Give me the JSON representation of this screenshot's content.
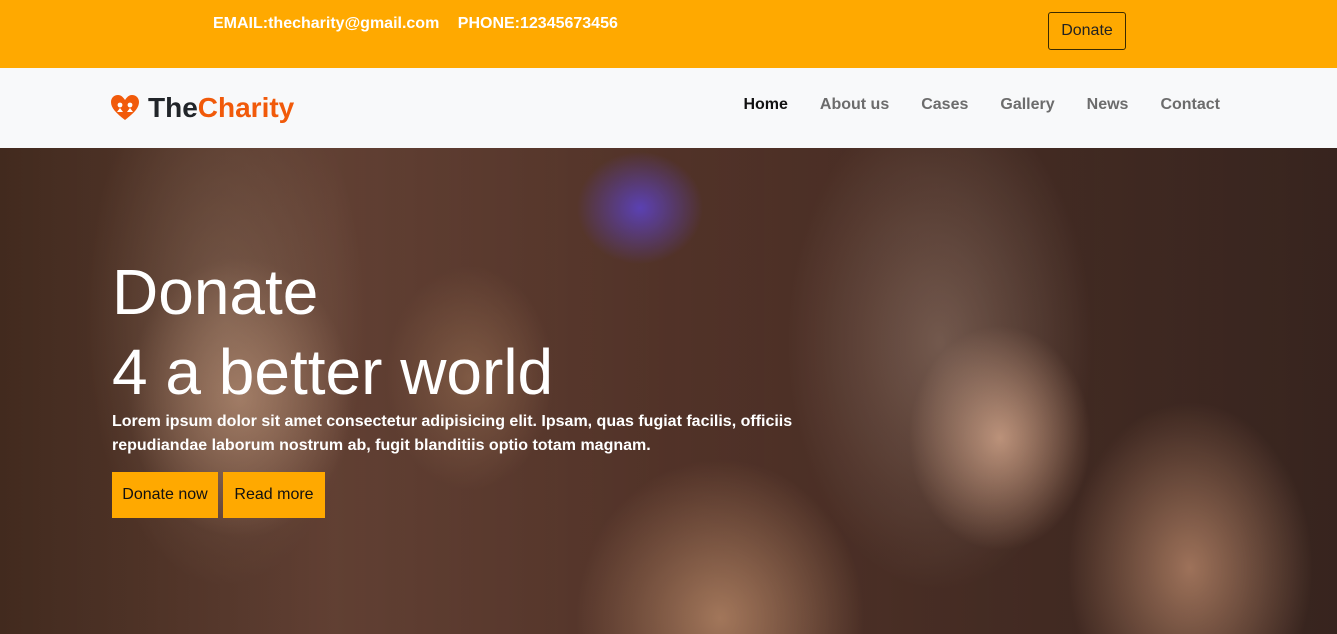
{
  "topbar": {
    "email": "EMAIL:thecharity@gmail.com",
    "phone": "PHONE:12345673456",
    "donate_label": "Donate"
  },
  "brand": {
    "name_part1": "The",
    "name_part2": "Charity",
    "icon": "heart-hands-icon"
  },
  "nav": {
    "items": [
      {
        "label": "Home",
        "active": true
      },
      {
        "label": "About us",
        "active": false
      },
      {
        "label": "Cases",
        "active": false
      },
      {
        "label": "Gallery",
        "active": false
      },
      {
        "label": "News",
        "active": false
      },
      {
        "label": "Contact",
        "active": false
      }
    ]
  },
  "hero": {
    "title_line1": "Donate",
    "title_line2": "4 a better world",
    "lead": "Lorem ipsum dolor sit amet consectetur adipisicing elit. Ipsam, quas fugiat facilis, officiis repudiandae laborum nostrum ab, fugit blanditiis optio totam magnam.",
    "donate_button": "Donate now",
    "read_button": "Read more"
  },
  "colors": {
    "accent": "#ffa900",
    "brand_orange": "#f15a0a",
    "nav_bg": "#f8f9fa"
  }
}
